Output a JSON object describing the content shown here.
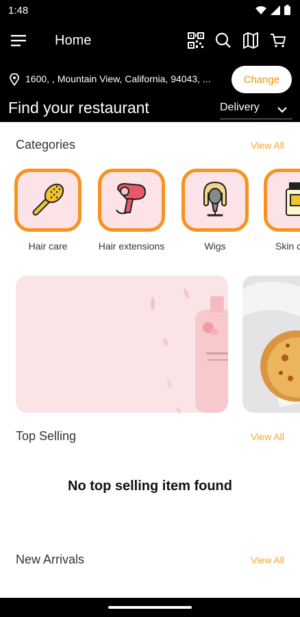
{
  "status_bar": {
    "time": "1:48"
  },
  "app_bar": {
    "title": "Home",
    "icons": [
      "menu-icon",
      "qr-code-icon",
      "search-icon",
      "map-icon",
      "cart-icon"
    ]
  },
  "location": {
    "address": "1600, , Mountain View, California, 94043, ...",
    "change_label": "Change"
  },
  "find": {
    "title": "Find your restaurant",
    "delivery_mode": "Delivery"
  },
  "categories": {
    "title": "Categories",
    "view_all": "View All",
    "items": [
      {
        "label": "Hair care",
        "icon": "hairbrush-icon"
      },
      {
        "label": "Hair extensions",
        "icon": "hair-dryer-icon"
      },
      {
        "label": "Wigs",
        "icon": "wig-icon"
      },
      {
        "label": "Skin c",
        "icon": "skincare-tube-icon"
      }
    ]
  },
  "top_selling": {
    "title": "Top Selling",
    "view_all": "View All",
    "empty_message": "No top selling item found"
  },
  "new_arrivals": {
    "title": "New Arrivals",
    "view_all": "View All"
  },
  "colors": {
    "accent": "#f7921e",
    "bar_bg": "#000000",
    "tile_bg": "#fbe3e8"
  }
}
